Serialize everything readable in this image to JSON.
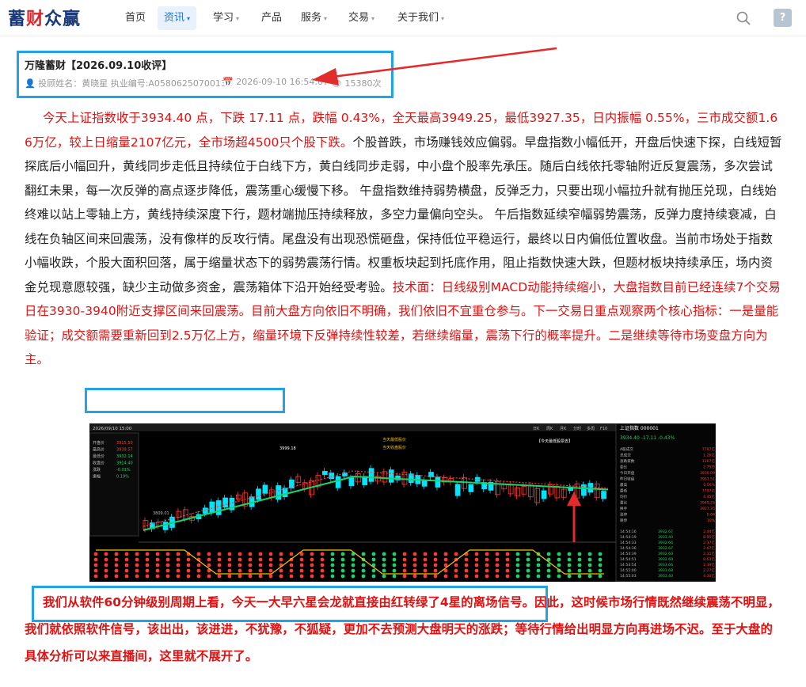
{
  "nav": {
    "logo_prefix": "蓄",
    "logo_red": "财",
    "logo_suffix": "众赢",
    "items": [
      {
        "label": "首页",
        "dropdown": false,
        "active": false
      },
      {
        "label": "资讯",
        "dropdown": true,
        "active": true
      },
      {
        "label": "学习",
        "dropdown": true,
        "active": false
      },
      {
        "label": "产品",
        "dropdown": false,
        "active": false
      },
      {
        "label": "服务",
        "dropdown": true,
        "active": false
      },
      {
        "label": "交易",
        "dropdown": true,
        "active": false
      },
      {
        "label": "关于我们",
        "dropdown": true,
        "active": false
      }
    ],
    "chevron": "⌄",
    "avatar_glyph": "?"
  },
  "article": {
    "title": "万隆蓄财【2026.09.10收评】",
    "author": "投顾姓名：黄晓星 执业编号:A0580625070013",
    "date": "2026-09-10 16:54:07",
    "views": "15380次"
  },
  "body": {
    "p1_red": "今天上证指数收于3934.40 点，下跌 17.11 点，跌幅 0.43%，全天最高3949.25，最低3927.35，日内振幅 0.55%，三市成交额1.66万亿，较上日缩量2107亿元，全市场超4500只个股下跌。",
    "p1_black": "个股普跌，市场赚钱效应偏弱。早盘指数小幅低开，开盘后快速下探，白线短暂探底后小幅回升，黄线同步走低且持续位于白线下方，黄白线同步走弱，中小盘个股率先承压。随后白线依托零轴附近反复震荡，多次尝试翻红未果，每一次反弹的高点逐步降低，震荡重心缓慢下移。 午盘指数维持弱势横盘，反弹乏力，只要出现小幅拉升就有抛压兑现，白线始终难以站上零轴上方，黄线持续深度下行，题材端抛压持续释放，多空力量偏向空头。 午后指数延续窄幅弱势震荡，反弹力度持续衰减，白线在负轴区间来回震荡，没有像样的反攻行情。尾盘没有出现恐慌砸盘，保持低位平稳运行，最终以日内偏低位置收盘。当前市场处于指数小幅收跌，个股大面积回落，属于缩量状态下的弱势震荡行情。权重板块起到托底作用，阻止指数快速大跌，但题材板块持续承压，场内资金兑现意愿较强，缺少主动做多资金，震荡箱体下沿开始经受考验。",
    "p1_red2": "技术面：日线级别MACD动能持续缩小，大盘指数目前已经连续7个交易日在3930-3940附近支撑区间来回震荡。目前大盘方向依旧不明确，我们依旧不宜重仓参与。下一交易日重点观察两个核心指标：一是量能验证；成交额需要重新回到2.5万亿上方，缩量环境下反弹持续性较差，若继续缩量，震荡下行的概率提升。",
    "p1_red3": "二是继续等待市场变盘方向为主。",
    "p2": "我们从软件60分钟级别周期上看，今天一大早六星会龙就直接由红转绿了4星的离场信号。因此，这时候市场行情既然继续震荡不明显，我们就依照软件信号，该出出，该进进，不犹豫，不狐疑，更加不去预测大盘明天的涨跌；等待行情给出明显方向再进场不迟。至于大盘的具体分析可以来直播间，这里就不展开了。"
  },
  "chart": {
    "index_name": "上证指数",
    "index_code": "000001",
    "last": "3934.40",
    "change": "-17.11",
    "pct": "-0.43%",
    "date_label": "2026/09/10 15:00",
    "high_label": "3999.18",
    "low_label": "3809.01",
    "left_rows": [
      {
        "k": "开盘价",
        "v": "3915.50"
      },
      {
        "k": "最高价",
        "v": "3939.57"
      },
      {
        "k": "最低价",
        "v": "3932.14"
      },
      {
        "k": "收盘价",
        "v": "3914.40"
      },
      {
        "k": "涨跌",
        "v": "-0.01%"
      },
      {
        "k": "振幅",
        "v": "0.19%"
      }
    ],
    "right_rows": [
      {
        "k": "A股成交",
        "v": "7797亿"
      },
      {
        "k": "总成交",
        "v": "1.26亿"
      },
      {
        "k": "涨跌家数",
        "v": "1167亿"
      },
      {
        "k": "委比",
        "v": "2.75万"
      },
      {
        "k": "今日开盘",
        "v": "3939.09"
      },
      {
        "k": "昨日收盘",
        "v": "3951.51"
      },
      {
        "k": "最高",
        "v": "0.56%"
      },
      {
        "k": "最低",
        "v": "7797亿"
      },
      {
        "k": "均价",
        "v": "4.45亿"
      },
      {
        "k": "量比",
        "v": "3949.25"
      },
      {
        "k": "换手",
        "v": "3927.35"
      },
      {
        "k": "涨停",
        "v": "0.04"
      },
      {
        "k": "跌停",
        "v": "10%"
      }
    ],
    "ticks": [
      {
        "t": "14:54:16",
        "p": "3932.67",
        "v": "2.44亿"
      },
      {
        "t": "14:54:19",
        "p": "3933.40",
        "v": "8.95亿"
      },
      {
        "t": "14:54:33",
        "p": "3932.66",
        "v": "2.37亿"
      },
      {
        "t": "14:54:36",
        "p": "3932.67",
        "v": "2.67亿"
      },
      {
        "t": "14:54:39",
        "p": "3932.60",
        "v": "2.31亿"
      },
      {
        "t": "14:54:51",
        "p": "3932.60",
        "v": "8.63亿"
      },
      {
        "t": "14:54:54",
        "p": "3933.66",
        "v": "2.39亿"
      },
      {
        "t": "14:55:00",
        "p": "3933.68",
        "v": "2.27亿"
      },
      {
        "t": "14:55:03",
        "p": "3933.40",
        "v": "4.30亿"
      }
    ],
    "legend_labels": [
      "日K",
      "周K",
      "月K",
      "分时",
      "多周",
      "F10"
    ],
    "annotation1": "当天最低股价",
    "annotation2": "当天收盘股价",
    "annotation3": "【今天最低股票去】",
    "colors": {
      "up": "#ff3b30",
      "down": "#00e5ff",
      "ma1": "#ffffff",
      "ma2": "#f2c300",
      "ma3": "#19d46b",
      "arrow": "#e22b2b"
    }
  }
}
